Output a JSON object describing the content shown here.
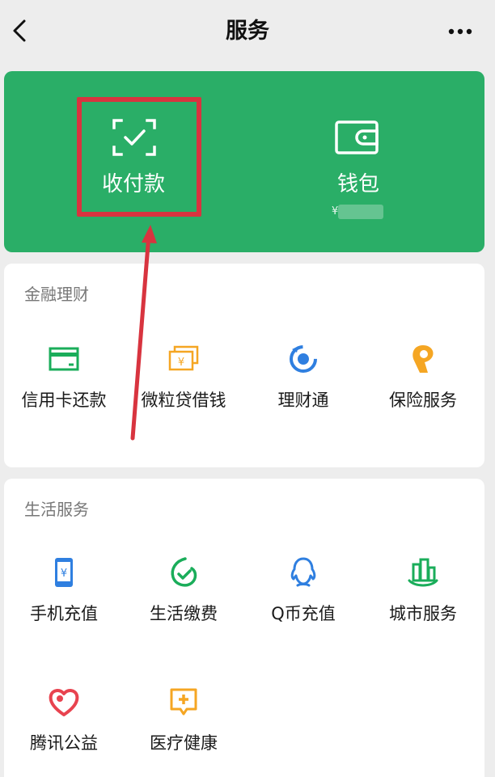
{
  "header": {
    "title": "服务"
  },
  "top_card": {
    "pay_label": "收付款",
    "wallet_label": "钱包",
    "wallet_balance_prefix": "¥"
  },
  "finance": {
    "title": "金融理财",
    "items": [
      {
        "label": "信用卡还款",
        "icon": "credit-card-icon"
      },
      {
        "label": "微粒贷借钱",
        "icon": "loan-icon"
      },
      {
        "label": "理财通",
        "icon": "wealth-icon"
      },
      {
        "label": "保险服务",
        "icon": "insurance-icon"
      }
    ]
  },
  "life": {
    "title": "生活服务",
    "items": [
      {
        "label": "手机充值",
        "icon": "phone-recharge-icon"
      },
      {
        "label": "生活缴费",
        "icon": "bill-payment-icon"
      },
      {
        "label": "Q币充值",
        "icon": "qq-coin-icon"
      },
      {
        "label": "城市服务",
        "icon": "city-service-icon"
      },
      {
        "label": "腾讯公益",
        "icon": "charity-icon"
      },
      {
        "label": "医疗健康",
        "icon": "medical-icon"
      }
    ]
  },
  "colors": {
    "brand_green": "#2aae67",
    "highlight_red": "#d8343f",
    "icon_green": "#1aad5a",
    "icon_orange": "#f5a623",
    "icon_blue": "#2f7fe0",
    "icon_red": "#e8434f"
  }
}
